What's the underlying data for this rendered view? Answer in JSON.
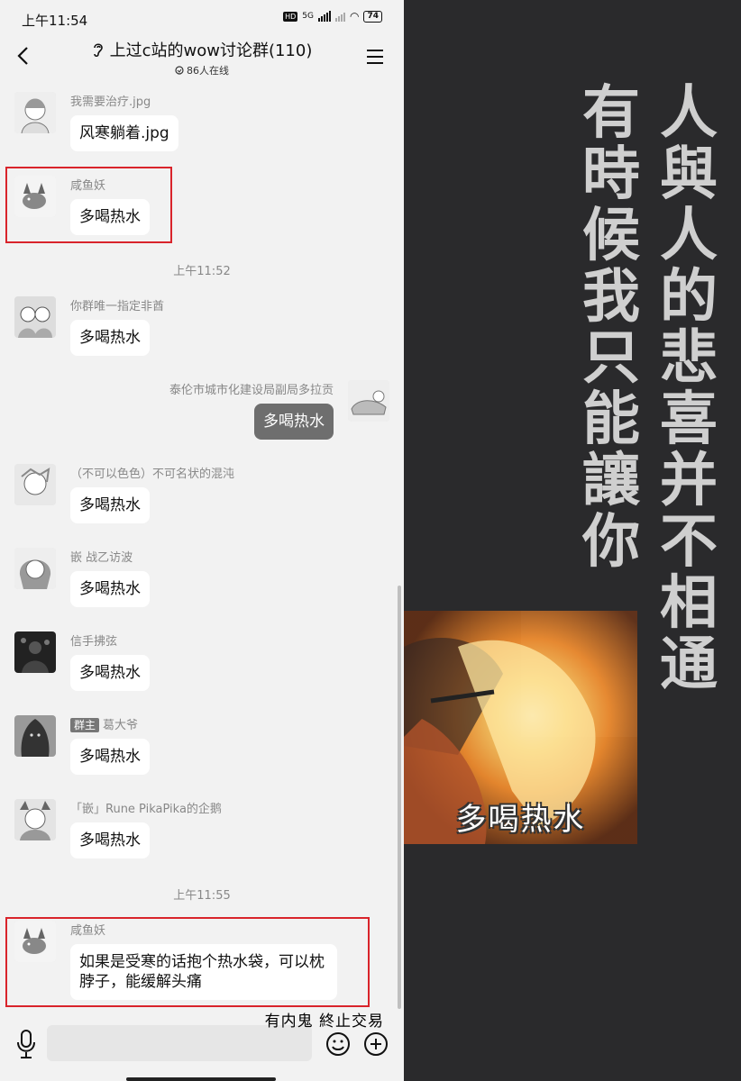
{
  "status_bar": {
    "time": "上午11:54",
    "hd": "HD",
    "network": "5G",
    "battery": "74"
  },
  "header": {
    "title": "上过c站的wow讨论群(110)",
    "online": "86人在线"
  },
  "messages": [
    {
      "sender": "我需要治疗.jpg",
      "text": "风寒躺着.jpg"
    },
    {
      "sender": "咸鱼妖",
      "text": "多喝热水"
    },
    {
      "sender": "你群唯一指定非酋",
      "text": "多喝热水"
    },
    {
      "sender": "泰伦市城市化建设局副局多拉贡",
      "text": "多喝热水"
    },
    {
      "sender": "（不可以色色）不可名状的混沌",
      "text": "多喝热水"
    },
    {
      "sender": "嵌 战乙访波",
      "text": "多喝热水"
    },
    {
      "sender": "信手拂弦",
      "text": "多喝热水"
    },
    {
      "sender": "葛大爷",
      "role": "群主",
      "text": "多喝热水"
    },
    {
      "sender": "「嵌」Rune PikaPika的企鹅",
      "text": "多喝热水"
    },
    {
      "sender": "咸鱼妖",
      "text": "如果是受寒的话抱个热水袋，可以枕脖子，能缓解头痛"
    }
  ],
  "timestamps": [
    "上午11:52",
    "上午11:55"
  ],
  "input": {
    "value": "",
    "placeholder": ""
  },
  "overlay_caption": "有内鬼  終止交易",
  "meme": {
    "column_right": "人與人的悲喜并不相通",
    "column_left": "有時候我只能讓你",
    "caption": "多喝热水"
  },
  "colors": {
    "highlight": "#d9242b",
    "self_bubble": "#6e6e6e",
    "panel_bg": "#2a2a2c"
  }
}
